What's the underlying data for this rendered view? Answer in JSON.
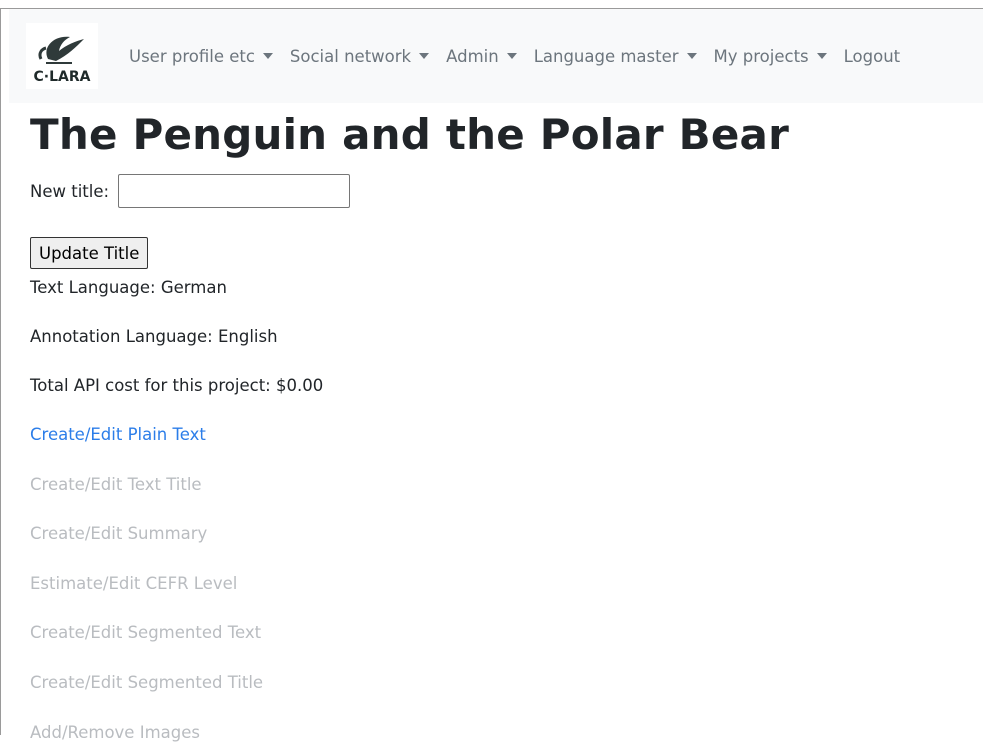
{
  "logo": {
    "text": "C·LARA"
  },
  "nav": {
    "items": [
      {
        "label": "User profile etc",
        "has_dropdown": true
      },
      {
        "label": "Social network",
        "has_dropdown": true
      },
      {
        "label": "Admin",
        "has_dropdown": true
      },
      {
        "label": "Language master",
        "has_dropdown": true
      },
      {
        "label": "My projects",
        "has_dropdown": true
      },
      {
        "label": "Logout",
        "has_dropdown": false
      }
    ]
  },
  "project": {
    "title": "The Penguin and the Polar Bear",
    "new_title_label": "New title:",
    "new_title_value": "",
    "update_button": "Update Title",
    "text_language": "Text Language: German",
    "annotation_language": "Annotation Language: English",
    "api_cost": "Total API cost for this project: $0.00"
  },
  "actions": [
    {
      "label": "Create/Edit Plain Text",
      "enabled": true
    },
    {
      "label": "Create/Edit Text Title",
      "enabled": false
    },
    {
      "label": "Create/Edit Summary",
      "enabled": false
    },
    {
      "label": "Estimate/Edit CEFR Level",
      "enabled": false
    },
    {
      "label": "Create/Edit Segmented Text",
      "enabled": false
    },
    {
      "label": "Create/Edit Segmented Title",
      "enabled": false
    },
    {
      "label": "Add/Remove Images",
      "enabled": false
    }
  ],
  "colors": {
    "link": "#2b7de9",
    "disabled": "#b9bcc0",
    "navbar_bg": "#f8f9fa"
  }
}
